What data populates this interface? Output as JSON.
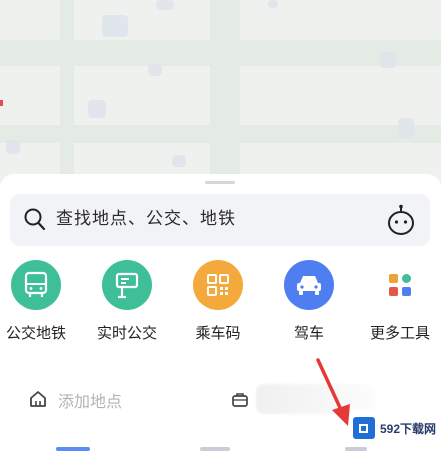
{
  "search": {
    "placeholder_text": "查找地点、公交、地铁",
    "assistant_icon": "robot-assistant-icon"
  },
  "tools": [
    {
      "label": "公交地铁",
      "icon": "bus-icon",
      "color": "#3fbf97"
    },
    {
      "label": "实时公交",
      "icon": "bus-stop-sign-icon",
      "color": "#3fbf97"
    },
    {
      "label": "乘车码",
      "icon": "qr-code-icon",
      "color": "#f4a93c"
    },
    {
      "label": "驾车",
      "icon": "car-icon",
      "color": "#4f7ef0"
    },
    {
      "label": "更多工具",
      "icon": "more-tools-grid-icon",
      "color": "#ffffff"
    }
  ],
  "shortcuts": {
    "home_label": "添加地点"
  },
  "watermark": {
    "text": "592下载网"
  }
}
